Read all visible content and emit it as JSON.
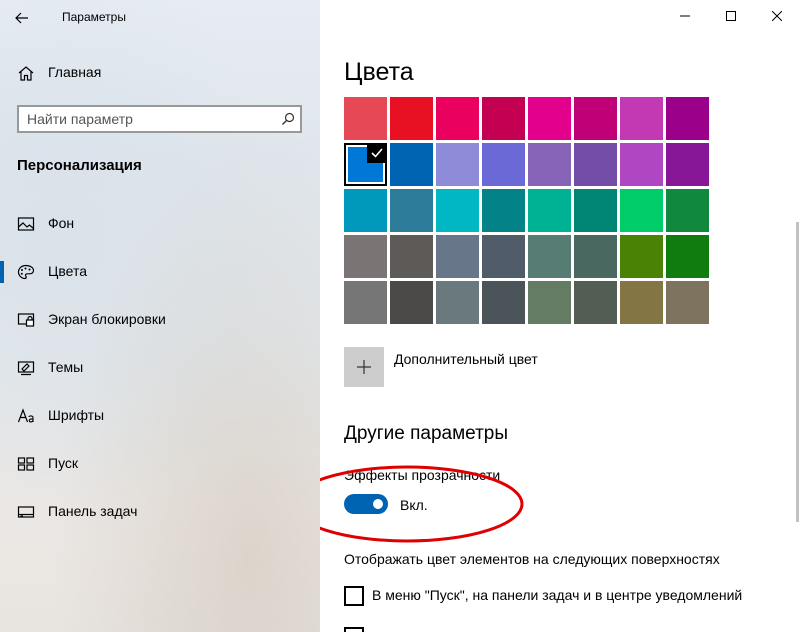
{
  "app": {
    "title": "Параметры"
  },
  "nav": {
    "home_label": "Главная",
    "search_placeholder": "Найти параметр",
    "section_title": "Персонализация",
    "items": [
      {
        "label": "Фон",
        "icon": "picture-icon",
        "selected": false
      },
      {
        "label": "Цвета",
        "icon": "palette-icon",
        "selected": true
      },
      {
        "label": "Экран блокировки",
        "icon": "lock-screen-icon",
        "selected": false
      },
      {
        "label": "Темы",
        "icon": "themes-icon",
        "selected": false
      },
      {
        "label": "Шрифты",
        "icon": "fonts-icon",
        "selected": false
      },
      {
        "label": "Пуск",
        "icon": "start-icon",
        "selected": false
      },
      {
        "label": "Панель задач",
        "icon": "taskbar-icon",
        "selected": false
      }
    ]
  },
  "main": {
    "title": "Цвета",
    "swatches": [
      [
        "#e74856",
        "#e81123",
        "#ea005e",
        "#c30052",
        "#e3008c",
        "#bf0077",
        "#c239b3",
        "#9a0089"
      ],
      [
        "#0078d7",
        "#0063b1",
        "#8e8cd8",
        "#6b69d6",
        "#8764b8",
        "#744da9",
        "#b146c2",
        "#881798"
      ],
      [
        "#0099bc",
        "#2d7d9a",
        "#00b7c3",
        "#038387",
        "#00b294",
        "#018574",
        "#00cc6a",
        "#10893e"
      ],
      [
        "#7a7574",
        "#5d5a58",
        "#68768a",
        "#515c6b",
        "#567c73",
        "#486860",
        "#498205",
        "#107c10"
      ],
      [
        "#767676",
        "#4c4a48",
        "#69797e",
        "#4a5459",
        "#647c64",
        "#525e54",
        "#847545",
        "#7e735f"
      ]
    ],
    "selected_swatch": "#0078d7",
    "custom_color_label": "Дополнительный цвет",
    "other_heading": "Другие параметры",
    "transparency_label": "Эффекты прозрачности",
    "transparency_on": true,
    "transparency_state": "Вкл.",
    "surfaces_label": "Отображать цвет элементов на следующих поверхностях",
    "checkbox_start_label": "В меню \"Пуск\", на панели задач и в центре уведомлений",
    "checkbox_start_checked": false
  },
  "colors": {
    "accent": "#0063b1",
    "annotation": "#e00000"
  }
}
